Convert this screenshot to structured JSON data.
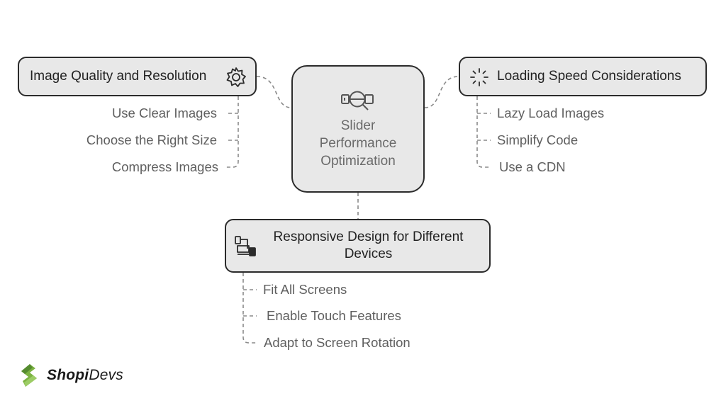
{
  "center": {
    "icon": "slider-search-icon",
    "title_lines": [
      "Slider",
      "Performance",
      "Optimization"
    ]
  },
  "branches": {
    "image_quality": {
      "title": "Image Quality and Resolution",
      "icon": "gear-icon",
      "items": [
        "Use Clear Images",
        "Choose the Right Size",
        "Compress Images"
      ]
    },
    "loading_speed": {
      "title": "Loading Speed Considerations",
      "icon": "loading-spinner-icon",
      "items": [
        "Lazy Load Images",
        "Simplify Code",
        "Use a CDN"
      ]
    },
    "responsive_design": {
      "title_lines": [
        "Responsive Design for Different",
        "Devices"
      ],
      "icon": "devices-icon",
      "items": [
        "Fit All Screens",
        "Enable Touch Features",
        "Adapt to Screen Rotation"
      ]
    }
  },
  "logo": {
    "brand_bold": "Shopi",
    "brand_light": "Devs",
    "accent_color": "#6aa84f"
  },
  "colors": {
    "box_fill": "#e8e8e8",
    "box_border": "#2b2b2b",
    "item_text": "#5f5f5f",
    "connector": "#8a8a8a"
  }
}
